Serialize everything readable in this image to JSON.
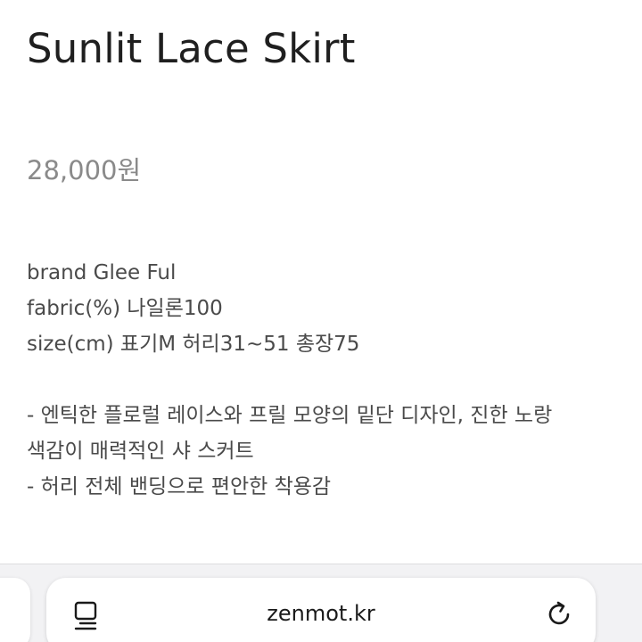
{
  "product": {
    "title": "Sunlit Lace Skirt",
    "price": "28,000원"
  },
  "details": {
    "brand": "brand Glee Ful",
    "fabric": "fabric(%) 나일론100",
    "size": "size(cm) 표기M 허리31~51 총장75",
    "description_line1": "- 엔틱한 플로럴 레이스와 프릴 모양의 밑단 디자인, 진한 노랑",
    "description_line2": "색감이 매력적인 샤 스커트",
    "description_line3": "- 허리 전체 밴딩으로 편안한 착용감"
  },
  "browser": {
    "url": "zenmot.kr",
    "left_icon": "reader-mode-icon",
    "right_icon": "reload-icon"
  }
}
